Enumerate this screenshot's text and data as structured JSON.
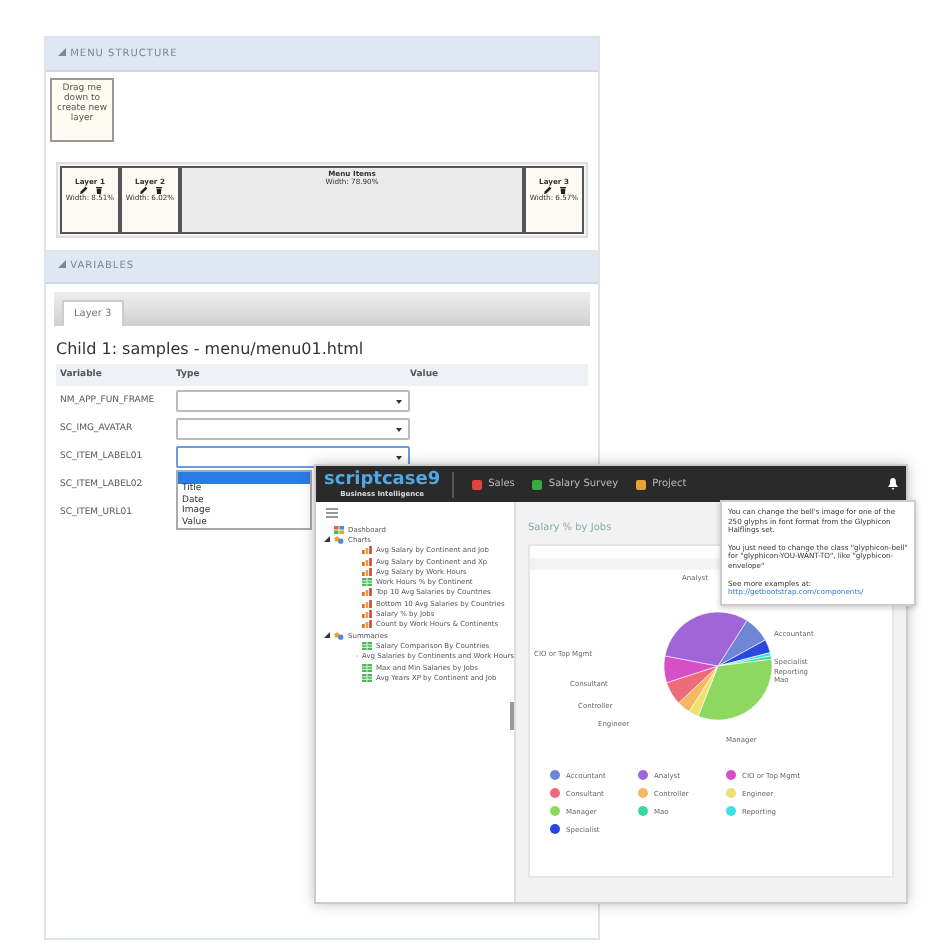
{
  "menu_structure": {
    "header": "MENU STRUCTURE",
    "drag_box": "Drag me down to create new layer",
    "layers": [
      {
        "kind": "layer",
        "name": "Layer 1",
        "width": "Width: 8.51%"
      },
      {
        "kind": "layer",
        "name": "Layer 2",
        "width": "Width: 6.02%"
      },
      {
        "kind": "menu",
        "name": "Menu Items",
        "width": "Width: 78.90%"
      },
      {
        "kind": "layer",
        "name": "Layer 3",
        "width": "Width: 6.57%"
      }
    ]
  },
  "variables": {
    "header": "VARIABLES",
    "tabs": [
      {
        "label": "Layer 3",
        "selected": true
      }
    ],
    "title": "Child 1: samples - menu/menu01.html",
    "columns": [
      "Variable",
      "Type",
      "Value"
    ],
    "rows": [
      {
        "variable": "NM_APP_FUN_FRAME",
        "expanded": false
      },
      {
        "variable": "SC_IMG_AVATAR",
        "expanded": false
      },
      {
        "variable": "SC_ITEM_LABEL01",
        "expanded": true,
        "options": [
          {
            "selected": true
          },
          {
            "label": "Title",
            "selected": false
          },
          {
            "label": "Date",
            "selected": false
          },
          {
            "label": "Image",
            "selected": false
          },
          {
            "label": "Value",
            "selected": false
          }
        ]
      },
      {
        "variable": "SC_ITEM_LABEL02"
      },
      {
        "variable": "SC_ITEM_URL01"
      }
    ]
  },
  "dashboard": {
    "logo": "scriptcase9",
    "logo_subtitle": "Business Intelligence",
    "nav": [
      {
        "label": "Sales",
        "color": "#e0443c"
      },
      {
        "label": "Salary Survey",
        "color": "#3aa843"
      },
      {
        "label": "Project",
        "color": "#e8a23a"
      }
    ],
    "tree": [
      {
        "label": "Dashboard",
        "kind": "dashboard"
      },
      {
        "label": "Charts",
        "kind": "folder",
        "expanded": true,
        "children": [
          {
            "label": "Avg Salary by Continent and Job",
            "kind": "chart"
          },
          {
            "label": "Avg Salary by Continent and Xp",
            "kind": "chart"
          },
          {
            "label": "Avg Salary by Work Hours",
            "kind": "chart"
          },
          {
            "label": "Work Hours % by Continent",
            "kind": "grid"
          },
          {
            "label": "Top 10 Avg Salaries by Countries",
            "kind": "chart"
          },
          {
            "label": "Bottom 10 Avg Salaries by Countries",
            "kind": "chart"
          },
          {
            "label": "Salary % by Jobs",
            "kind": "chart"
          },
          {
            "label": "Count by Work Hours & Continents",
            "kind": "chart"
          }
        ]
      },
      {
        "label": "Summaries",
        "kind": "folder",
        "expanded": true,
        "children": [
          {
            "label": "Salary Comparison By Countries",
            "kind": "grid"
          },
          {
            "label": "Avg Salaries by Continents and Work Hours",
            "kind": "grid"
          },
          {
            "label": "Max and Min Salaries by Jobs",
            "kind": "grid"
          },
          {
            "label": "Avg Years XP by Continent and Job",
            "kind": "grid"
          }
        ]
      }
    ],
    "content_title": "Salary % by Jobs",
    "tooltip": {
      "text": "You can change the bell's image for one of the 250 glyphs in font format from the Glyphicon Halflings set.",
      "text2": "You just need to change the class \"glyphicon-bell\" for \"glyphicon-YOU-WANT-TO\", like \"glyphicon-envelope\"",
      "more": "See more examples at:",
      "link": "http://getbootstrap.com/components/"
    },
    "pie_labels": [
      "Analyst",
      "Accountant",
      "CIO or Top Mgmt",
      "Specialist",
      "Reporting",
      "Mao",
      "Consultant",
      "Controller",
      "Engineer",
      "Manager"
    ],
    "legend": [
      {
        "label": "Accountant",
        "color": "#6f86d6"
      },
      {
        "label": "Analyst",
        "color": "#a066d8"
      },
      {
        "label": "CIO or Top Mgmt",
        "color": "#d64fc8"
      },
      {
        "label": "Consultant",
        "color": "#ee6b7a"
      },
      {
        "label": "Controller",
        "color": "#f5b860"
      },
      {
        "label": "Engineer",
        "color": "#efe070"
      },
      {
        "label": "Manager",
        "color": "#8cd860"
      },
      {
        "label": "Mao",
        "color": "#3cd8a0"
      },
      {
        "label": "Reporting",
        "color": "#40e0e8"
      },
      {
        "label": "Specialist",
        "color": "#2a48e0"
      }
    ]
  }
}
